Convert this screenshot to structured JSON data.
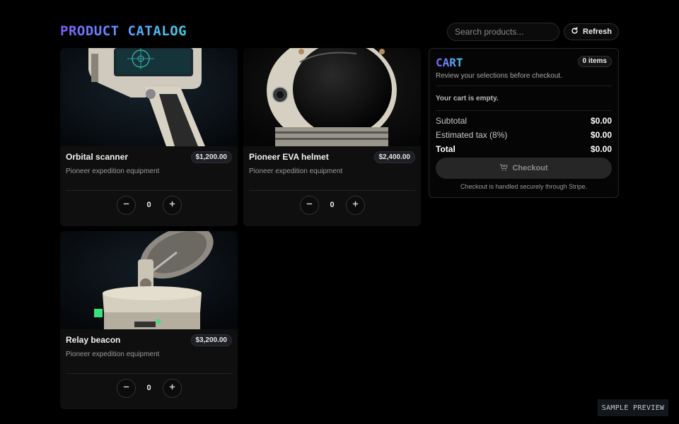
{
  "header": {
    "title": "PRODUCT CATALOG",
    "search_placeholder": "Search products...",
    "refresh_label": "Refresh"
  },
  "products": [
    {
      "name": "Orbital scanner",
      "price": "$1,200.00",
      "description": "Pioneer expedition equipment",
      "quantity": "0"
    },
    {
      "name": "Pioneer EVA helmet",
      "price": "$2,400.00",
      "description": "Pioneer expedition equipment",
      "quantity": "0"
    },
    {
      "name": "Relay beacon",
      "price": "$3,200.00",
      "description": "Pioneer expedition equipment",
      "quantity": "0"
    }
  ],
  "cart": {
    "title": "CART",
    "items_badge": "0 items",
    "subtitle": "Review your selections before checkout.",
    "empty_message": "Your cart is empty.",
    "subtotal_label": "Subtotal",
    "subtotal_value": "$0.00",
    "tax_label": "Estimated tax (8%)",
    "tax_value": "$0.00",
    "total_label": "Total",
    "total_value": "$0.00",
    "checkout_label": "Checkout",
    "checkout_note": "Checkout is handled securely through Stripe."
  },
  "badge": {
    "preview_label": "SAMPLE PREVIEW"
  },
  "icons": {
    "refresh": "refresh-icon",
    "minus": "minus-icon",
    "plus": "plus-icon",
    "cart": "cart-icon"
  },
  "colors": {
    "background": "#000000",
    "title_gradient_start": "#7c5cff",
    "title_gradient_end": "#3fd0e0",
    "card_bg": "#0f0f0f"
  }
}
